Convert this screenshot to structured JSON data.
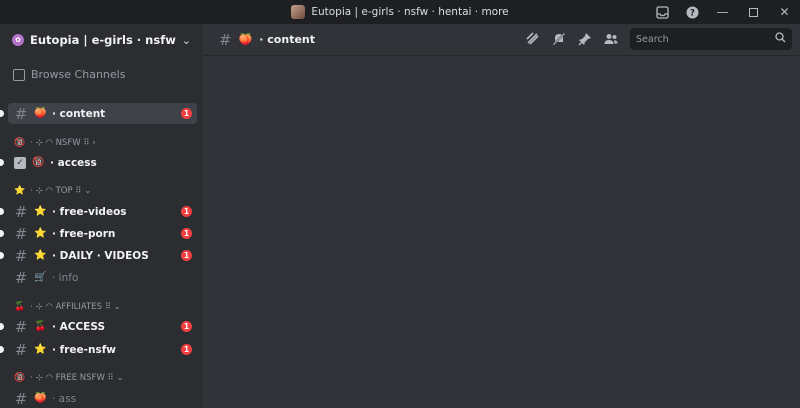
{
  "window": {
    "title": "Eutopia | e-girls · nsfw · hentai · more"
  },
  "guild": {
    "name": "Eutopia | e-girls · nsfw · hent..."
  },
  "browse_label": "Browse Channels",
  "channels": [
    {
      "emoji": "🍑",
      "name": "· content",
      "badge": "1",
      "active": true,
      "muted": false
    },
    {
      "emoji": "🔞",
      "name": "· access",
      "badge": "",
      "active": false,
      "muted": false,
      "check": true
    },
    {
      "emoji": "⭐",
      "name": "· free-videos",
      "badge": "1"
    },
    {
      "emoji": "⭐",
      "name": "· free-porn",
      "badge": "1"
    },
    {
      "emoji": "⭐",
      "name": "· DAILY · VIDEOS",
      "badge": "1"
    },
    {
      "emoji": "🛒",
      "name": "· info",
      "badge": "",
      "muted": true
    },
    {
      "emoji": "🍒",
      "name": "· ACCESS",
      "badge": "1"
    },
    {
      "emoji": "⭐",
      "name": "· free-nsfw",
      "badge": "1"
    },
    {
      "emoji": "🍑",
      "name": "· ass",
      "badge": "",
      "muted": true
    }
  ],
  "categories": [
    {
      "emoji": "🔞",
      "label": "· ⊹ ◠ NSFW ⠿ ›"
    },
    {
      "emoji": "⭐",
      "label": "· ⊹ ◠ TOP ⠿ ⌄"
    },
    {
      "emoji": "🍒",
      "label": "· ⊹ ◠ AFFILIATES ⠿ ⌄"
    },
    {
      "emoji": "🔞",
      "label": "· ⊹ ◠ FREE NSFW ⠿ ⌄"
    }
  ],
  "header": {
    "emoji": "🍑",
    "channel": "· content",
    "search_placeholder": "Search"
  },
  "colors": {
    "sidebar": "#2b2d31",
    "main": "#313338",
    "titlebar": "#1e1f22",
    "badge": "#f23f42",
    "active_row": "#404249"
  }
}
